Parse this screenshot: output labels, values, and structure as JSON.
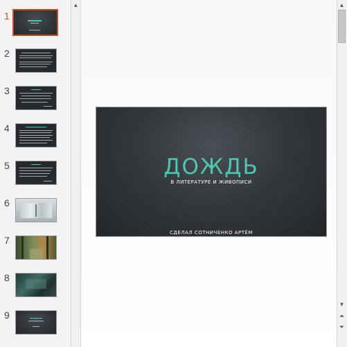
{
  "thumbnails": [
    {
      "number": "1",
      "style": "title"
    },
    {
      "number": "2",
      "style": "text"
    },
    {
      "number": "3",
      "style": "text"
    },
    {
      "number": "4",
      "style": "text-heading"
    },
    {
      "number": "5",
      "style": "text"
    },
    {
      "number": "6",
      "style": "image-light"
    },
    {
      "number": "7",
      "style": "image-forest"
    },
    {
      "number": "8",
      "style": "image-dark"
    },
    {
      "number": "9",
      "style": "title-small"
    }
  ],
  "slide": {
    "title": "ДОЖДЬ",
    "subtitle": "В ЛИТЕРАТУРЕ И ЖИВОПИСИ",
    "author": "СДЕЛАЛ СОТНИЧЕНКО АРТЁМ"
  },
  "colors": {
    "accent": "#d24726",
    "title": "#4fc6b3",
    "slide_bg": "#2b2f33"
  }
}
